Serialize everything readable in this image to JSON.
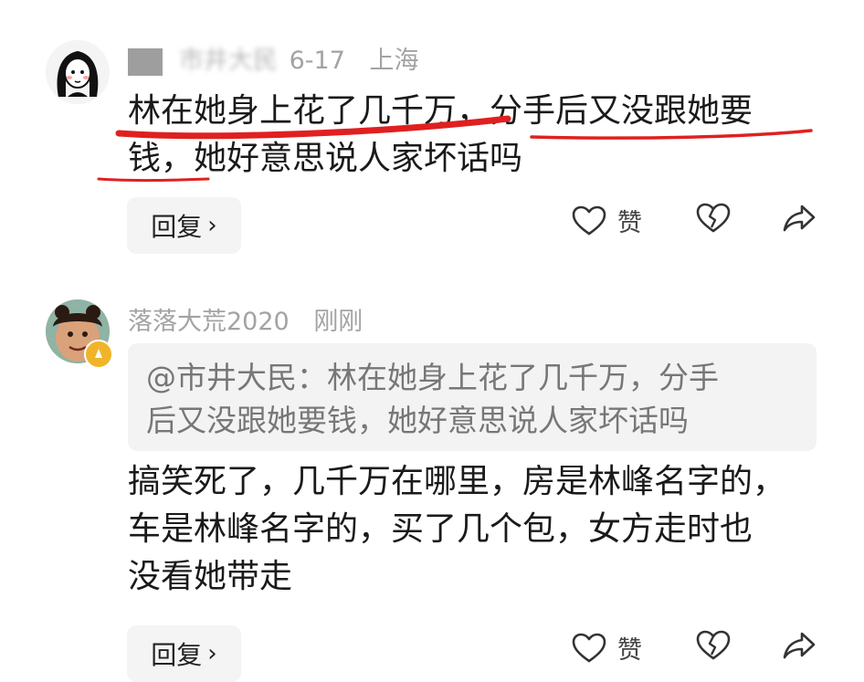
{
  "comments": [
    {
      "meta": {
        "name": "市井大民",
        "date": "6-17",
        "location": "上海"
      },
      "text_line1": "林在她身上花了几千万，分手后又没跟她要",
      "text_line2": "钱，她好意思说人家坏话吗",
      "reply_label": "回复",
      "like_label": "赞"
    },
    {
      "meta": {
        "name": "落落大荒2020",
        "time": "刚刚"
      },
      "quote": {
        "line1": "@市井大民：林在她身上花了几千万，分手",
        "line2": "后又没跟她要钱，她好意思说人家坏话吗"
      },
      "text_line1": "搞笑死了，几千万在哪里，房是林峰名字的，",
      "text_line2": "车是林峰名字的，买了几个包，女方走时也",
      "text_line3": "没看她带走",
      "reply_label": "回复",
      "like_label": "赞"
    }
  ],
  "icons": {
    "reply_chevron": "chevron-right-icon",
    "like": "heart-outline-icon",
    "dislike": "broken-heart-icon",
    "share": "share-arrow-icon"
  },
  "colors": {
    "annotation_red": "#e02020",
    "muted_text": "#a3a3a3",
    "quote_bg": "#f3f3f3",
    "badge": "#f0b429"
  }
}
